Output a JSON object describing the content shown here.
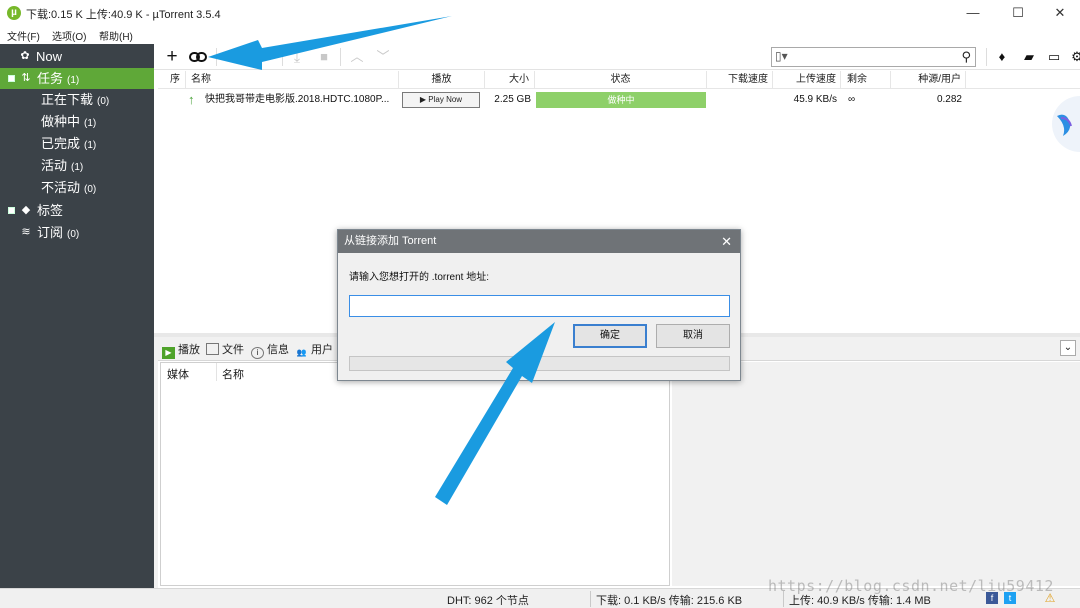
{
  "app": {
    "logo": "µ",
    "title": "下载:0.15 K 上传:40.9 K - µTorrent 3.5.4",
    "window_controls": [
      "—",
      "☐",
      "✕"
    ]
  },
  "menu": [
    "文件(F)",
    "选项(O)",
    "帮助(H)"
  ],
  "sidebar": {
    "now": "Now",
    "tasks": {
      "label": "任务",
      "count": "(1)"
    },
    "items": [
      {
        "label": "正在下载",
        "count": "(0)"
      },
      {
        "label": "做种中",
        "count": "(1)"
      },
      {
        "label": "已完成",
        "count": "(1)"
      },
      {
        "label": "活动",
        "count": "(1)"
      },
      {
        "label": "不活动",
        "count": "(0)"
      }
    ],
    "labels": "标签",
    "feeds": {
      "label": "订阅",
      "count": "(0)"
    }
  },
  "columns": {
    "seq": "序",
    "name": "名称",
    "play": "播放",
    "size": "大小",
    "status": "状态",
    "down": "下载速度",
    "up": "上传速度",
    "eta": "剩余",
    "ratio": "种源/用户"
  },
  "torrents": [
    {
      "name": "快把我哥带走电影版.2018.HDTC.1080P...",
      "play_label": "▶ Play Now",
      "size": "2.25 GB",
      "status": "做种中",
      "down_speed": "",
      "up_speed": "45.9 KB/s",
      "eta": "∞",
      "ratio": "0.282"
    }
  ],
  "detail_tabs": [
    "播放",
    "文件",
    "信息",
    "用户"
  ],
  "media_pane": {
    "col_media": "媒体",
    "col_name": "名称"
  },
  "statusbar": {
    "dht": "DHT: 962 个节点",
    "download": "下载: 0.1 KB/s 传输: 215.6 KB",
    "upload": "上传: 40.9 KB/s 传输: 1.4 MB"
  },
  "dialog": {
    "title": "从链接添加 Torrent",
    "prompt": "请输入您想打开的 .torrent 地址:",
    "url_value": "",
    "ok": "确定",
    "cancel": "取消",
    "close": "✕"
  },
  "watermark": "https://blog.csdn.net/liu59412",
  "colors": {
    "accent": "#5fa838",
    "annotation": "#1a9be0",
    "sidebar": "#3b4248",
    "dialog_title": "#6f7377"
  }
}
